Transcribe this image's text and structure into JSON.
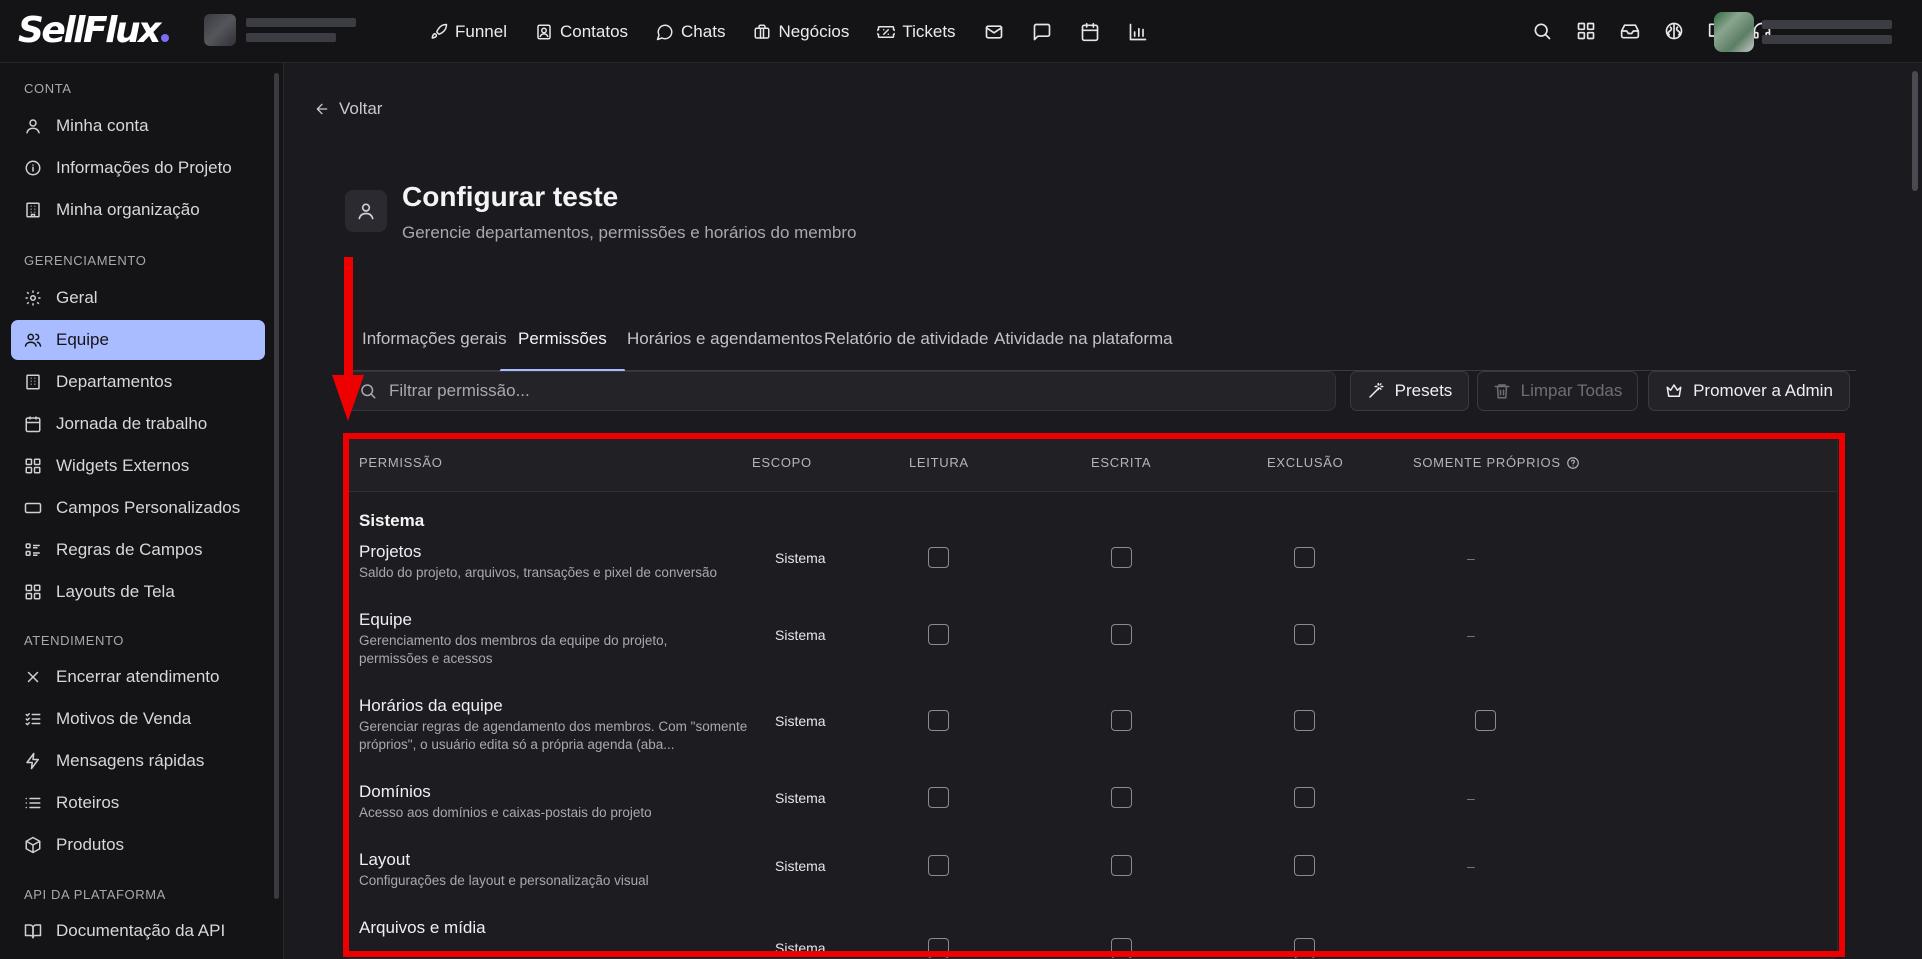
{
  "brand": {
    "logo": "SellFlux",
    "accent": "#a9bcff"
  },
  "topnav": {
    "items": [
      {
        "label": "Funnel",
        "icon": "rocket-icon"
      },
      {
        "label": "Contatos",
        "icon": "contact-card-icon"
      },
      {
        "label": "Chats",
        "icon": "chat-bubble-icon"
      },
      {
        "label": "Negócios",
        "icon": "briefcase-icon"
      },
      {
        "label": "Tickets",
        "icon": "ticket-icon"
      }
    ],
    "icon_only": [
      "mail-icon",
      "message-square-icon",
      "calendar-icon",
      "bar-chart-icon"
    ],
    "right_icons": [
      "search-icon",
      "apps-icon",
      "inbox-icon",
      "brain-icon",
      "book-icon",
      "headset-icon"
    ]
  },
  "sidebar": {
    "sections": [
      {
        "title": "CONTA",
        "items": [
          "Minha conta",
          "Informações do Projeto",
          "Minha organização"
        ]
      },
      {
        "title": "GERENCIAMENTO",
        "items": [
          "Geral",
          "Equipe",
          "Departamentos",
          "Jornada de trabalho",
          "Widgets Externos",
          "Campos Personalizados",
          "Regras de Campos",
          "Layouts de Tela"
        ]
      },
      {
        "title": "ATENDIMENTO",
        "items": [
          "Encerrar atendimento",
          "Motivos de Venda",
          "Mensagens rápidas",
          "Roteiros",
          "Produtos"
        ]
      },
      {
        "title": "API DA PLATAFORMA",
        "items": [
          "Documentação da API"
        ]
      }
    ],
    "active": "Equipe"
  },
  "page": {
    "back_label": "Voltar",
    "title": "Configurar teste",
    "subtitle": "Gerencie departamentos, permissões e horários do membro",
    "tabs": [
      "Informações gerais",
      "Permissões",
      "Horários e agendamentos",
      "Relatório de atividade",
      "Atividade na plataforma"
    ],
    "active_tab": "Permissões"
  },
  "toolbar": {
    "filter_placeholder": "Filtrar permissão...",
    "presets": "Presets",
    "clear_all": "Limpar Todas",
    "promote": "Promover a Admin"
  },
  "table": {
    "columns": [
      "PERMISSÃO",
      "ESCOPO",
      "LEITURA",
      "ESCRITA",
      "EXCLUSÃO",
      "SOMENTE PRÓPRIOS"
    ],
    "group": "Sistema",
    "rows": [
      {
        "name": "Projetos",
        "desc": "Saldo do projeto, arquivos, transações e pixel de conversão",
        "scope": "Sistema",
        "own": "–"
      },
      {
        "name": "Equipe",
        "desc": "Gerenciamento dos membros da equipe do projeto, permissões e acessos",
        "scope": "Sistema",
        "own": "–"
      },
      {
        "name": "Horários da equipe",
        "desc": "Gerenciar regras de agendamento dos membros. Com \"somente próprios\", o usuário edita só a própria agenda (aba...",
        "scope": "Sistema",
        "own": "checkbox"
      },
      {
        "name": "Domínios",
        "desc": "Acesso aos domínios e caixas-postais do projeto",
        "scope": "Sistema",
        "own": "–"
      },
      {
        "name": "Layout",
        "desc": "Configurações de layout e personalização visual",
        "scope": "Sistema",
        "own": "–"
      },
      {
        "name": "Arquivos e mídia",
        "desc": "",
        "scope": "Sistema",
        "own": ""
      }
    ]
  }
}
